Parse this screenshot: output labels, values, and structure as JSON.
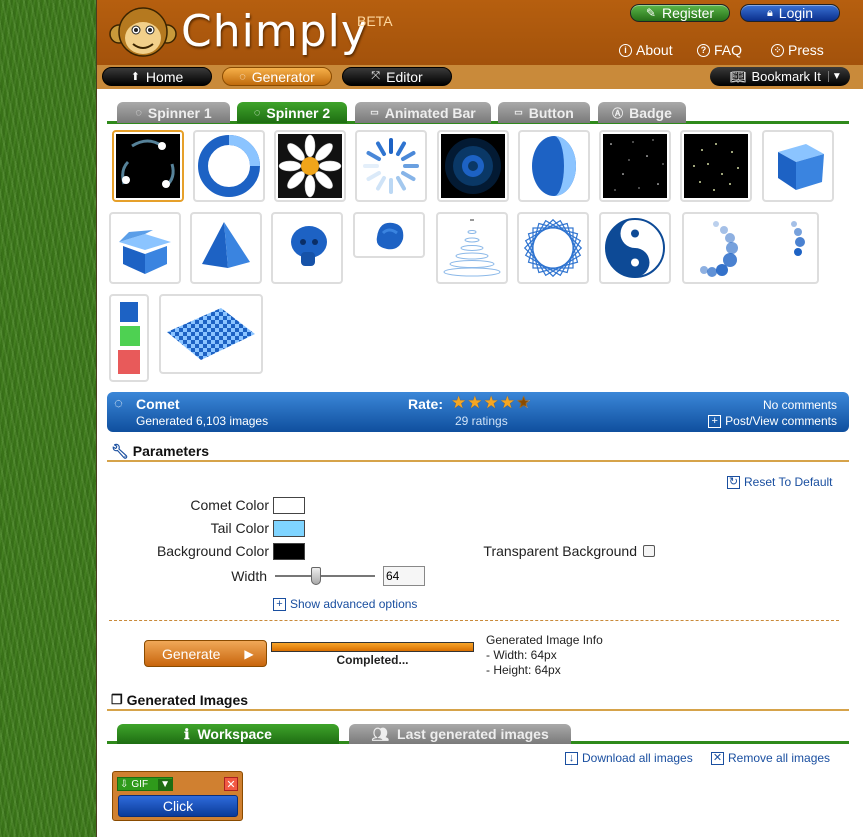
{
  "header": {
    "logo_text": "Chimply",
    "beta": "BETA",
    "register": "Register",
    "login": "Login",
    "links": {
      "about": "About",
      "faq": "FAQ",
      "press": "Press"
    }
  },
  "nav": {
    "home": "Home",
    "generator": "Generator",
    "editor": "Editor",
    "bookmark": "Bookmark It"
  },
  "tabs": [
    "Spinner 1",
    "Spinner 2",
    "Animated Bar",
    "Button",
    "Badge"
  ],
  "active_tab": "Spinner 2",
  "thumbnails": [
    "comet",
    "ring",
    "daisy",
    "radial-spokes",
    "pulse",
    "sphere",
    "starfield-1",
    "starfield-2",
    "cube",
    "open-box",
    "pyramid",
    "skull",
    "knot",
    "spiral-rings",
    "rotating-squares",
    "yin-yang",
    "bubble-trail",
    "color-cubes",
    "checker-plane"
  ],
  "selected_spinner": {
    "name": "Comet",
    "generated": "Generated 6,103 images",
    "rate_label": "Rate:",
    "ratings": "29 ratings",
    "rating_value": 4.5,
    "comments": "No comments",
    "post_view": "Post/View comments"
  },
  "parameters": {
    "title": "Parameters",
    "reset": "Reset To Default",
    "comet_color_label": "Comet Color",
    "tail_color_label": "Tail Color",
    "bg_color_label": "Background Color",
    "width_label": "Width",
    "width_value": "64",
    "transparent_label": "Transparent Background",
    "advanced": "Show advanced options",
    "comet_color": "#ffffff",
    "tail_color": "#7fd4ff",
    "bg_color": "#000000",
    "slider_fraction": 0.4
  },
  "generate": {
    "button": "Generate",
    "status": "Completed...",
    "progress": 1.0,
    "info_title": "Generated Image Info",
    "info_width": "- Width: 64px",
    "info_height": "- Height: 64px"
  },
  "generated_images": {
    "title": "Generated Images",
    "workspace_tab": "Workspace",
    "last_tab": "Last generated images",
    "download_all": "Download all images",
    "remove_all": "Remove all images",
    "widget_format": "GIF",
    "widget_button": "Click"
  },
  "colors": {
    "brand_orange": "#b65f0f",
    "accent_green": "#2f8a1b",
    "info_blue": "#0f4f9e"
  }
}
